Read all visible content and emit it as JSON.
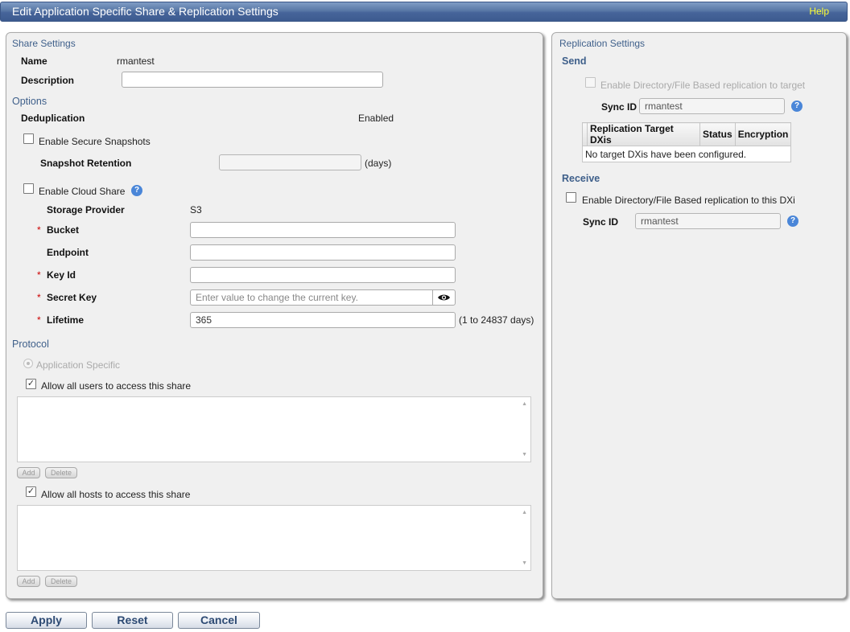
{
  "window": {
    "title": "Edit Application Specific Share & Replication Settings",
    "help_label": "Help"
  },
  "share_settings": {
    "title": "Share Settings",
    "name_label": "Name",
    "name_value": "rmantest",
    "description_label": "Description",
    "description_value": ""
  },
  "options": {
    "title": "Options",
    "dedup_label": "Deduplication",
    "dedup_value": "Enabled",
    "secure_snapshots_label": "Enable Secure Snapshots",
    "secure_snapshots_checked": false,
    "snapshot_retention_label": "Snapshot Retention",
    "snapshot_retention_value": "",
    "snapshot_retention_unit": "(days)",
    "cloud_share_label": "Enable Cloud Share",
    "cloud_share_checked": false,
    "storage_provider_label": "Storage Provider",
    "storage_provider_value": "S3",
    "bucket_label": "Bucket",
    "bucket_value": "",
    "endpoint_label": "Endpoint",
    "endpoint_value": "",
    "key_id_label": "Key Id",
    "key_id_value": "",
    "secret_key_label": "Secret Key",
    "secret_key_placeholder": "Enter value to change the current key.",
    "lifetime_label": "Lifetime",
    "lifetime_value": "365",
    "lifetime_hint": "(1 to 24837 days)",
    "required_mark": "*"
  },
  "protocol": {
    "title": "Protocol",
    "app_specific_label": "Application Specific",
    "allow_users_label": "Allow all users to access this share",
    "allow_users_checked": true,
    "allow_hosts_label": "Allow all hosts to access this share",
    "allow_hosts_checked": true,
    "add_label": "Add",
    "delete_label": "Delete"
  },
  "replication": {
    "title": "Replication Settings",
    "send_title": "Send",
    "send_enable_label": "Enable Directory/File Based replication to target",
    "send_sync_label": "Sync ID",
    "send_sync_value": "rmantest",
    "table_headers": [
      "Replication Target DXis",
      "Status",
      "Encryption"
    ],
    "table_empty": "No target DXis have been configured.",
    "receive_title": "Receive",
    "receive_enable_label": "Enable Directory/File Based replication to this DXi",
    "receive_sync_label": "Sync ID",
    "receive_sync_value": "rmantest"
  },
  "footer": {
    "apply_label": "Apply",
    "reset_label": "Reset",
    "cancel_label": "Cancel"
  },
  "icons": {
    "help": "help-icon",
    "eye": "eye-icon",
    "check": "check-icon"
  }
}
